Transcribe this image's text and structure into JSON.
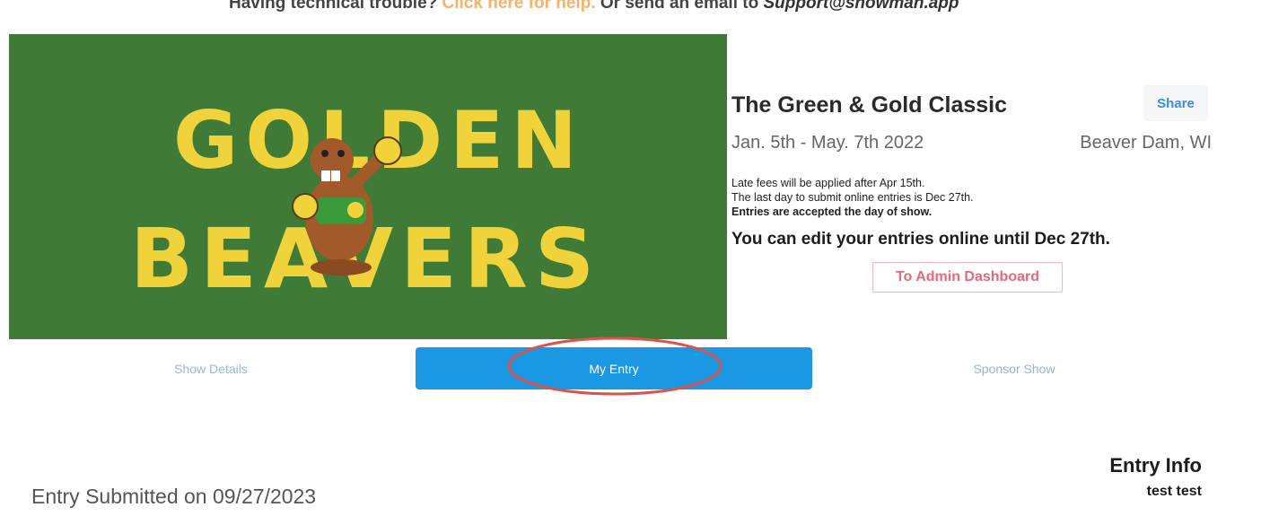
{
  "top_notice": {
    "prefix": "Having technical trouble? ",
    "help_link": "Click here for help.",
    "middle": " Or send an email to ",
    "email": "Support@showman.app"
  },
  "banner": {
    "line1": "GOLDEN",
    "line2": "BEAVERS",
    "bg_color": "#3f7a37",
    "text_color": "#f0d23a"
  },
  "show": {
    "title": "The Green & Gold Classic",
    "share_label": "Share",
    "dates": "Jan. 5th - May. 7th 2022",
    "location": "Beaver Dam, WI",
    "notes": [
      "Late fees will be applied after Apr 15th.",
      "The last day to submit online entries is Dec 27th.",
      "Entries are accepted the day of show."
    ],
    "edit_note": "You can edit your entries online until Dec 27th.",
    "admin_button": "To Admin Dashboard"
  },
  "tabs": {
    "details": "Show Details",
    "entry": "My Entry",
    "sponsor": "Sponsor Show"
  },
  "entry": {
    "submitted": "Entry Submitted on 09/27/2023",
    "info_title": "Entry Info",
    "name": "test test"
  },
  "colors": {
    "accent": "#1a98e3",
    "link": "#3a8fd9",
    "admin": "#e36a78",
    "annotation": "#d9534f"
  }
}
